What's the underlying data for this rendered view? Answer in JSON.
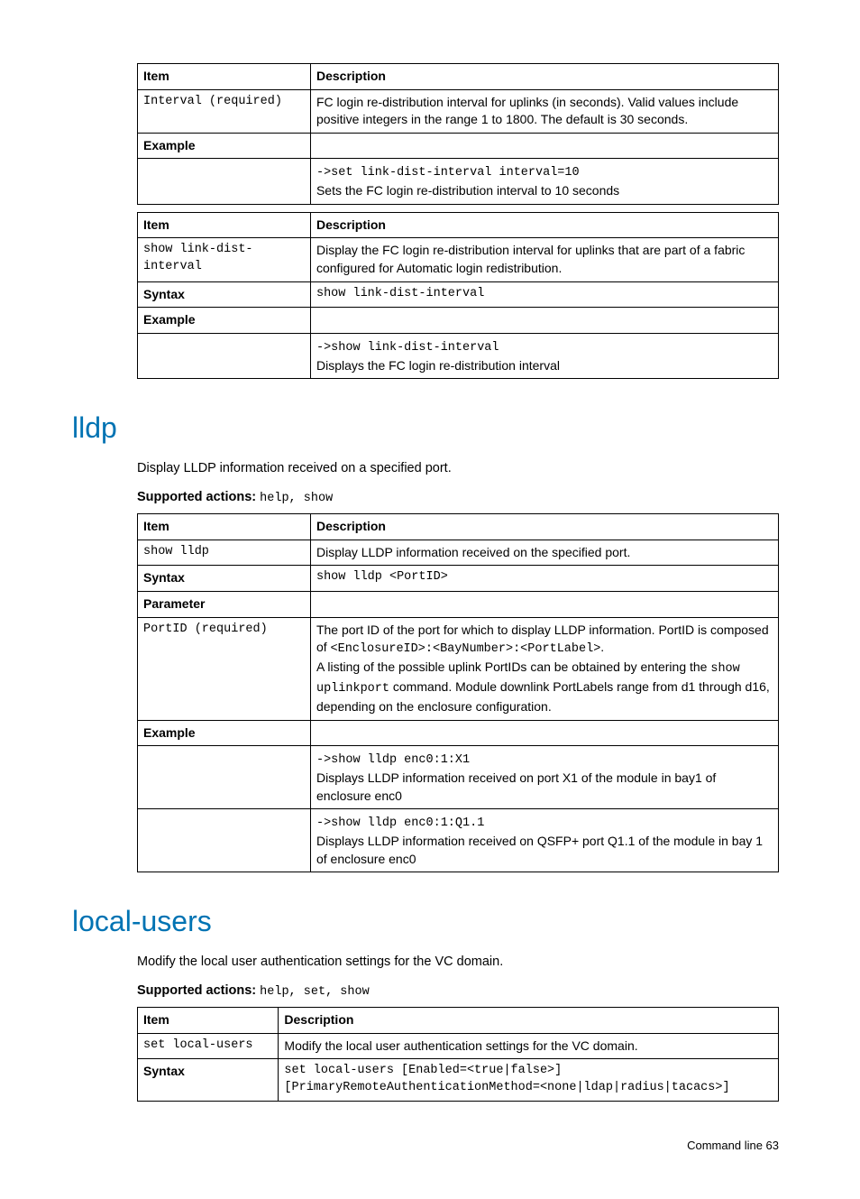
{
  "tables": {
    "t1": {
      "h1": "Item",
      "h2": "Description",
      "r1c1": "Interval (required)",
      "r1c2": "FC login re-distribution interval for uplinks (in seconds). Valid values include positive integers in the range 1 to 1800. The default is 30 seconds.",
      "r2c1": "Example",
      "r3c2a": "->set link-dist-interval interval=10",
      "r3c2b": "Sets the FC login re-distribution interval to 10 seconds"
    },
    "t2": {
      "h1": "Item",
      "h2": "Description",
      "r1c1": "show link-dist-interval",
      "r1c2": "Display the FC login re-distribution interval for uplinks that are part of a fabric configured for Automatic login redistribution.",
      "r2c1": "Syntax",
      "r2c2": "show link-dist-interval",
      "r3c1": "Example",
      "r4c2a": "->show link-dist-interval",
      "r4c2b": "Displays the FC login re-distribution interval"
    },
    "lldp": {
      "heading": "lldp",
      "intro": "Display LLDP information received on a specified port.",
      "supported_label": "Supported actions",
      "supported_actions": "help, show",
      "h1": "Item",
      "h2": "Description",
      "r1c1": "show lldp",
      "r1c2": "Display LLDP information received on the specified port.",
      "r2c1": "Syntax",
      "r2c2": "show lldp <PortID>",
      "r3c1": "Parameter",
      "r4c1": "PortID (required)",
      "r4c2a": "The port ID of the port for which to display LLDP information. PortID is composed of ",
      "r4c2b": "<EnclosureID>:<BayNumber>:<PortLabel>",
      "r4c2c": ".",
      "r4c2d": "A listing of the possible uplink PortIDs can be obtained by entering the ",
      "r4c2e": "show uplinkport",
      "r4c2f": " command. Module downlink PortLabels range from d1 through d16, depending on the enclosure configuration.",
      "r5c1": "Example",
      "r6c2a": "->show lldp enc0:1:X1",
      "r6c2b": "Displays LLDP information received on port X1 of the module in bay1 of enclosure enc0",
      "r7c2a": "->show lldp enc0:1:Q1.1",
      "r7c2b": "Displays LLDP information received on QSFP+ port Q1.1 of the module in bay 1 of enclosure enc0"
    },
    "localusers": {
      "heading": "local-users",
      "intro": "Modify the local user authentication settings for the VC domain.",
      "supported_label": "Supported actions",
      "supported_actions": "help, set, show",
      "h1": "Item",
      "h2": "Description",
      "r1c1": "set local-users",
      "r1c2": "Modify the local user authentication settings for the VC domain.",
      "r2c1": "Syntax",
      "r2c2": "set local-users [Enabled=<true|false>] [PrimaryRemoteAuthenticationMethod=<none|ldap|radius|tacacs>]"
    }
  },
  "footer": "Command line   63"
}
